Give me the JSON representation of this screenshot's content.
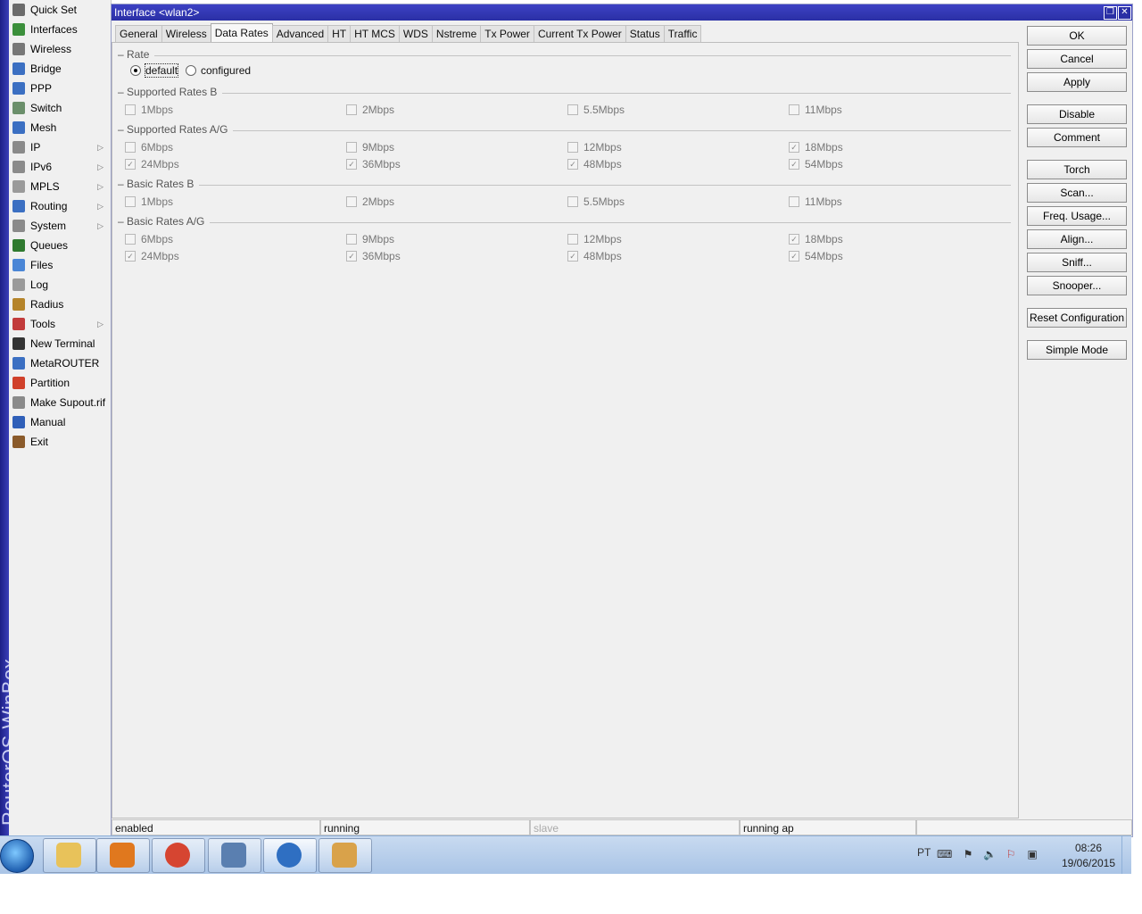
{
  "brand": {
    "text": "RouterOS WinBox"
  },
  "menu": {
    "items": [
      {
        "label": "Quick Set",
        "icon": "quick-set-icon",
        "color": "#6b6b6b",
        "submenu": false
      },
      {
        "label": "Interfaces",
        "icon": "interfaces-icon",
        "color": "#3b8f3b",
        "submenu": false
      },
      {
        "label": "Wireless",
        "icon": "wireless-icon",
        "color": "#777777",
        "submenu": false
      },
      {
        "label": "Bridge",
        "icon": "bridge-icon",
        "color": "#3b6fc2",
        "submenu": false
      },
      {
        "label": "PPP",
        "icon": "ppp-icon",
        "color": "#3b6fc2",
        "submenu": false
      },
      {
        "label": "Switch",
        "icon": "switch-icon",
        "color": "#6b8f6b",
        "submenu": false
      },
      {
        "label": "Mesh",
        "icon": "mesh-icon",
        "color": "#3b6fc2",
        "submenu": false
      },
      {
        "label": "IP",
        "icon": "ip-icon",
        "color": "#8a8a8a",
        "submenu": true
      },
      {
        "label": "IPv6",
        "icon": "ipv6-icon",
        "color": "#8a8a8a",
        "submenu": true
      },
      {
        "label": "MPLS",
        "icon": "mpls-icon",
        "color": "#9a9a9a",
        "submenu": true
      },
      {
        "label": "Routing",
        "icon": "routing-icon",
        "color": "#3b6fc2",
        "submenu": true
      },
      {
        "label": "System",
        "icon": "system-icon",
        "color": "#8a8a8a",
        "submenu": true
      },
      {
        "label": "Queues",
        "icon": "queues-icon",
        "color": "#2f7a2f",
        "submenu": false
      },
      {
        "label": "Files",
        "icon": "files-icon",
        "color": "#4a86d6",
        "submenu": false
      },
      {
        "label": "Log",
        "icon": "log-icon",
        "color": "#9a9a9a",
        "submenu": false
      },
      {
        "label": "Radius",
        "icon": "radius-icon",
        "color": "#b5842a",
        "submenu": false
      },
      {
        "label": "Tools",
        "icon": "tools-icon",
        "color": "#c23b3b",
        "submenu": true
      },
      {
        "label": "New Terminal",
        "icon": "terminal-icon",
        "color": "#333333",
        "submenu": false
      },
      {
        "label": "MetaROUTER",
        "icon": "metarouter-icon",
        "color": "#3b6fc2",
        "submenu": false
      },
      {
        "label": "Partition",
        "icon": "partition-icon",
        "color": "#d0402a",
        "submenu": false
      },
      {
        "label": "Make Supout.rif",
        "icon": "supout-icon",
        "color": "#8a8a8a",
        "submenu": false
      },
      {
        "label": "Manual",
        "icon": "manual-icon",
        "color": "#2f5fb8",
        "submenu": false
      },
      {
        "label": "Exit",
        "icon": "exit-icon",
        "color": "#8a5a2a",
        "submenu": false
      }
    ]
  },
  "window": {
    "title": "Interface <wlan2>",
    "tabs": [
      "General",
      "Wireless",
      "Data Rates",
      "Advanced",
      "HT",
      "HT MCS",
      "WDS",
      "Nstreme",
      "Tx Power",
      "Current Tx Power",
      "Status",
      "Traffic"
    ],
    "active_tab": "Data Rates",
    "rate": {
      "heading": "Rate",
      "options": [
        "default",
        "configured"
      ],
      "selected": "default"
    },
    "sections": [
      {
        "title": "Supported Rates B",
        "rows": [
          [
            {
              "label": "1Mbps",
              "checked": false
            },
            {
              "label": "2Mbps",
              "checked": false
            },
            {
              "label": "5.5Mbps",
              "checked": false
            },
            {
              "label": "11Mbps",
              "checked": false
            }
          ]
        ]
      },
      {
        "title": "Supported Rates A/G",
        "rows": [
          [
            {
              "label": "6Mbps",
              "checked": false
            },
            {
              "label": "9Mbps",
              "checked": false
            },
            {
              "label": "12Mbps",
              "checked": false
            },
            {
              "label": "18Mbps",
              "checked": true
            }
          ],
          [
            {
              "label": "24Mbps",
              "checked": true
            },
            {
              "label": "36Mbps",
              "checked": true
            },
            {
              "label": "48Mbps",
              "checked": true
            },
            {
              "label": "54Mbps",
              "checked": true
            }
          ]
        ]
      },
      {
        "title": "Basic Rates B",
        "rows": [
          [
            {
              "label": "1Mbps",
              "checked": false
            },
            {
              "label": "2Mbps",
              "checked": false
            },
            {
              "label": "5.5Mbps",
              "checked": false
            },
            {
              "label": "11Mbps",
              "checked": false
            }
          ]
        ]
      },
      {
        "title": "Basic Rates A/G",
        "rows": [
          [
            {
              "label": "6Mbps",
              "checked": false
            },
            {
              "label": "9Mbps",
              "checked": false
            },
            {
              "label": "12Mbps",
              "checked": false
            },
            {
              "label": "18Mbps",
              "checked": true
            }
          ],
          [
            {
              "label": "24Mbps",
              "checked": true
            },
            {
              "label": "36Mbps",
              "checked": true
            },
            {
              "label": "48Mbps",
              "checked": true
            },
            {
              "label": "54Mbps",
              "checked": true
            }
          ]
        ]
      }
    ],
    "buttons": [
      {
        "label": "OK",
        "group": 0
      },
      {
        "label": "Cancel",
        "group": 0
      },
      {
        "label": "Apply",
        "group": 0
      },
      {
        "label": "Disable",
        "group": 1
      },
      {
        "label": "Comment",
        "group": 1
      },
      {
        "label": "Torch",
        "group": 2
      },
      {
        "label": "Scan...",
        "group": 2
      },
      {
        "label": "Freq. Usage...",
        "group": 2
      },
      {
        "label": "Align...",
        "group": 2
      },
      {
        "label": "Sniff...",
        "group": 2
      },
      {
        "label": "Snooper...",
        "group": 2
      },
      {
        "label": "Reset Configuration",
        "group": 3
      },
      {
        "label": "Simple Mode",
        "group": 4
      }
    ],
    "status": [
      {
        "text": "enabled",
        "dim": false
      },
      {
        "text": "running",
        "dim": false
      },
      {
        "text": "slave",
        "dim": true
      },
      {
        "text": "running ap",
        "dim": false
      },
      {
        "text": "",
        "dim": false
      }
    ]
  },
  "taskbar": {
    "apps": [
      {
        "icon": "file-explorer-icon",
        "color": "#e8c25a"
      },
      {
        "icon": "media-player-icon",
        "color": "#e0781e"
      },
      {
        "icon": "chrome-icon",
        "color": "#d64531"
      },
      {
        "icon": "network-config-icon",
        "color": "#5a7fb0"
      },
      {
        "icon": "winbox-icon",
        "color": "#2f6fc2"
      },
      {
        "icon": "paint-icon",
        "color": "#d9a24a"
      }
    ],
    "active_app": 4,
    "tray": {
      "language": "PT",
      "time": "08:26",
      "date": "19/06/2015"
    }
  }
}
